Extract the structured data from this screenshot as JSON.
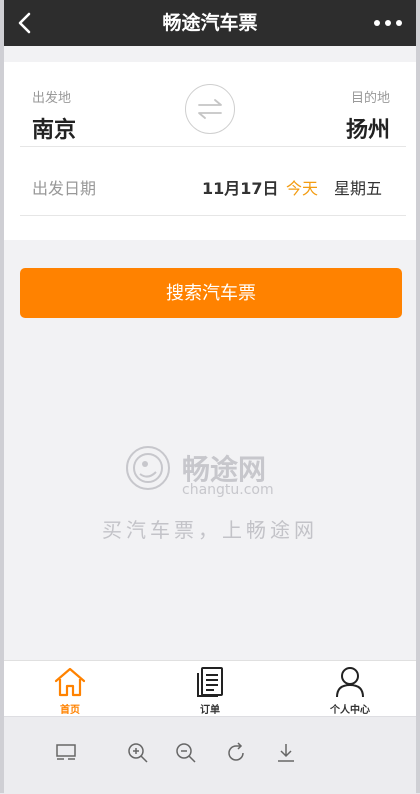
{
  "header": {
    "title": "畅途汽车票",
    "back_icon": "chevron-left-icon",
    "more_icon": "more-dots-icon"
  },
  "trip": {
    "from_label": "出发地",
    "from_city": "南京",
    "to_label": "目的地",
    "to_city": "扬州",
    "swap_icon": "swap-arrows-icon",
    "date_label": "出发日期",
    "date_value": "11月17日",
    "today_label": "今天",
    "weekday": "星期五"
  },
  "search": {
    "label": "搜索汽车票"
  },
  "brand": {
    "logo_cn": "畅途网",
    "logo_en": "changtu.com",
    "slogan": "买汽车票，上畅途网"
  },
  "tabs": [
    {
      "label": "首页",
      "icon": "home-icon",
      "active": true
    },
    {
      "label": "订单",
      "icon": "orders-icon",
      "active": false
    },
    {
      "label": "个人中心",
      "icon": "user-icon",
      "active": false
    }
  ],
  "browser_toolbar": {
    "icons": [
      "layout-icon",
      "zoom-in-icon",
      "zoom-out-icon",
      "rotate-icon",
      "download-icon"
    ]
  },
  "colors": {
    "accent": "#ff8200",
    "today": "#f39c12",
    "header_bg": "#2d2d2d"
  }
}
